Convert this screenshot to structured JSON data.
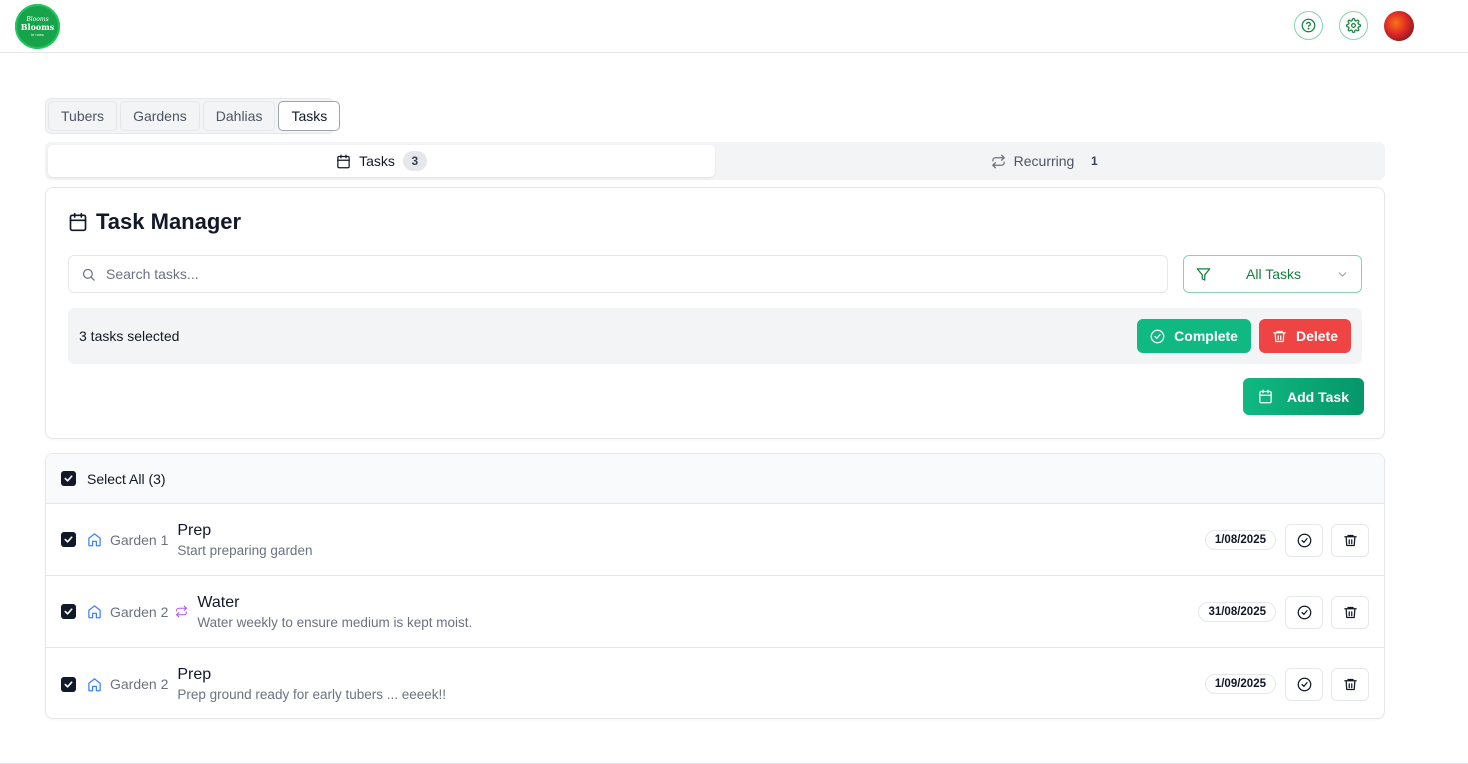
{
  "header": {
    "logo": {
      "line1": "Blooms",
      "line2": "Blooms",
      "line3": "in rows"
    },
    "help_icon": "help-circle-icon",
    "settings_icon": "gear-icon",
    "avatar_icon": "user-avatar"
  },
  "main_tabs": [
    {
      "label": "Tubers",
      "active": false
    },
    {
      "label": "Gardens",
      "active": false
    },
    {
      "label": "Dahlias",
      "active": false
    },
    {
      "label": "Tasks",
      "active": true
    }
  ],
  "sub_tabs": [
    {
      "label": "Tasks",
      "count": "3",
      "icon": "calendar-icon",
      "active": true
    },
    {
      "label": "Recurring",
      "count": "1",
      "icon": "repeat-icon",
      "active": false
    }
  ],
  "manager": {
    "title": "Task Manager",
    "search": {
      "placeholder": "Search tasks...",
      "value": ""
    },
    "filter": {
      "selected": "All Tasks"
    },
    "selection_text": "3 tasks selected",
    "complete_label": "Complete",
    "delete_label": "Delete",
    "add_task_label": "Add Task"
  },
  "list": {
    "select_all_label": "Select All (3)",
    "rows": [
      {
        "garden": "Garden 1",
        "recurring": false,
        "title": "Prep",
        "description": "Start preparing garden",
        "date": "1/08/2025",
        "checked": true
      },
      {
        "garden": "Garden 2",
        "recurring": true,
        "title": "Water",
        "description": "Water weekly to ensure medium is kept moist.",
        "date": "31/08/2025",
        "checked": true
      },
      {
        "garden": "Garden 2",
        "recurring": false,
        "title": "Prep",
        "description": "Prep ground ready for early tubers ... eeeek!!",
        "date": "1/09/2025",
        "checked": true
      }
    ]
  },
  "colors": {
    "accent": "#10b981",
    "danger": "#ef4444",
    "garden_icon": "#3b82f6",
    "recurring_icon": "#a855f7"
  }
}
